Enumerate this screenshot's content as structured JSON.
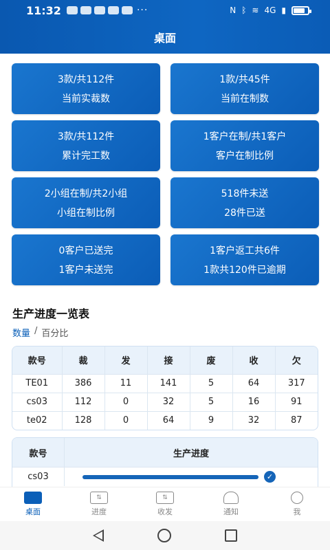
{
  "status_bar": {
    "time": "11:32",
    "more": "···",
    "network": "4G",
    "battery_level": 0.8
  },
  "header": {
    "title": "桌面"
  },
  "cards": [
    {
      "line1": "3款/共112件",
      "line2": "当前实裁数"
    },
    {
      "line1": "1款/共45件",
      "line2": "当前在制数"
    },
    {
      "line1": "3款/共112件",
      "line2": "累计完工数"
    },
    {
      "line1": "1客户在制/共1客户",
      "line2": "客户在制比例"
    },
    {
      "line1": "2小组在制/共2小组",
      "line2": "小组在制比例"
    },
    {
      "line1": "518件未送",
      "line2": "28件已送"
    },
    {
      "line1": "0客户已送完",
      "line2": "1客户未送完"
    },
    {
      "line1": "1客户返工共6件",
      "line2": "1款共120件已逾期"
    }
  ],
  "progress_section": {
    "title": "生产进度一览表",
    "toggle": {
      "option1": "数量",
      "separator": "/",
      "option2": "百分比"
    }
  },
  "table1": {
    "headers": [
      "款号",
      "裁",
      "发",
      "接",
      "废",
      "收",
      "欠"
    ],
    "rows": [
      [
        "TE01",
        "386",
        "11",
        "141",
        "5",
        "64",
        "317"
      ],
      [
        "cs03",
        "112",
        "0",
        "32",
        "5",
        "16",
        "91"
      ],
      [
        "te02",
        "128",
        "0",
        "64",
        "9",
        "32",
        "87"
      ]
    ]
  },
  "table2": {
    "headers": [
      "款号",
      "生产进度"
    ],
    "rows": [
      {
        "code": "cs03",
        "progress": 1.0
      }
    ]
  },
  "bottom_nav": [
    {
      "label": "桌面",
      "icon": "desktop-icon",
      "active": true
    },
    {
      "label": "进度",
      "icon": "progress-icon",
      "active": false
    },
    {
      "label": "收发",
      "icon": "transfer-icon",
      "active": false
    },
    {
      "label": "通知",
      "icon": "bell-icon",
      "active": false
    },
    {
      "label": "我",
      "icon": "profile-icon",
      "active": false
    }
  ],
  "colors": {
    "primary": "#0b5fb8",
    "card": "#1565c0",
    "header": "#0a58b0"
  }
}
